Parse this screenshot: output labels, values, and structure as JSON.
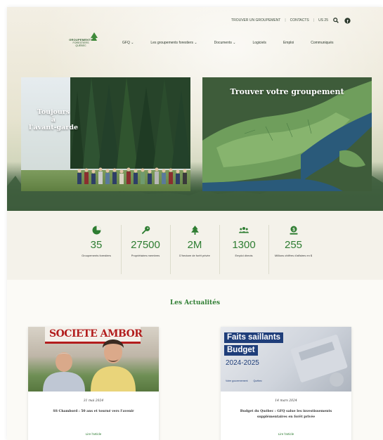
{
  "topbar": {
    "find_group": "TROUVER UN GROUPEMENT",
    "contacts": "CONTACTS",
    "lang": "US 25",
    "search_icon": "search-icon",
    "social_icon": "facebook-icon"
  },
  "logo": {
    "line1": "GROUPEMENTS",
    "line2": "FORESTIERS",
    "line3": "QUÉBEC"
  },
  "nav": {
    "items": [
      {
        "label": "GFQ ⌄"
      },
      {
        "label": "Les groupements forestiers ⌄"
      },
      {
        "label": "Documents ⌄"
      },
      {
        "label": "Logiciels"
      },
      {
        "label": "Emploi"
      },
      {
        "label": "Communiqués"
      }
    ]
  },
  "hero": {
    "photo_caption_1": "Toujours",
    "photo_caption_2": "à",
    "photo_caption_3": "l'avant-garde",
    "map_title": "Trouver votre groupement"
  },
  "stats": [
    {
      "icon": "pie-chart-icon",
      "value": "35",
      "label": "Groupements forestiers"
    },
    {
      "icon": "key-icon",
      "value": "27500",
      "label": "Propriétaires membres"
    },
    {
      "icon": "tree-icon",
      "value": "2M",
      "label": "D'hectare de forêt privée"
    },
    {
      "icon": "people-icon",
      "value": "1300",
      "label": "Emploi directs"
    },
    {
      "icon": "money-icon",
      "value": "255",
      "label": "Millions chiffres d'affaires en $"
    }
  ],
  "news": {
    "title": "Les Actualités",
    "items": [
      {
        "sign_text": "SOCIETE  AMBOR",
        "date": "31 mai 2024",
        "headline": "SS Chambord : 50 ans et tourné vers l'avenir",
        "more": "Lire l'article"
      },
      {
        "badge1": "Faits saillants",
        "badge2": "Budget",
        "year": "2024-2025",
        "gov1": "Votre gouvernement",
        "gov2": "Québec",
        "date": "14 mars 2024",
        "headline": "Budget du Québec : GFQ salue les investissements supplémentaires en forêt privée",
        "more": "Lire l'article"
      }
    ]
  },
  "colors": {
    "accent_green": "#2e7d32",
    "dark_green": "#2e5a2e",
    "quebec_blue": "#1f3e7a"
  }
}
